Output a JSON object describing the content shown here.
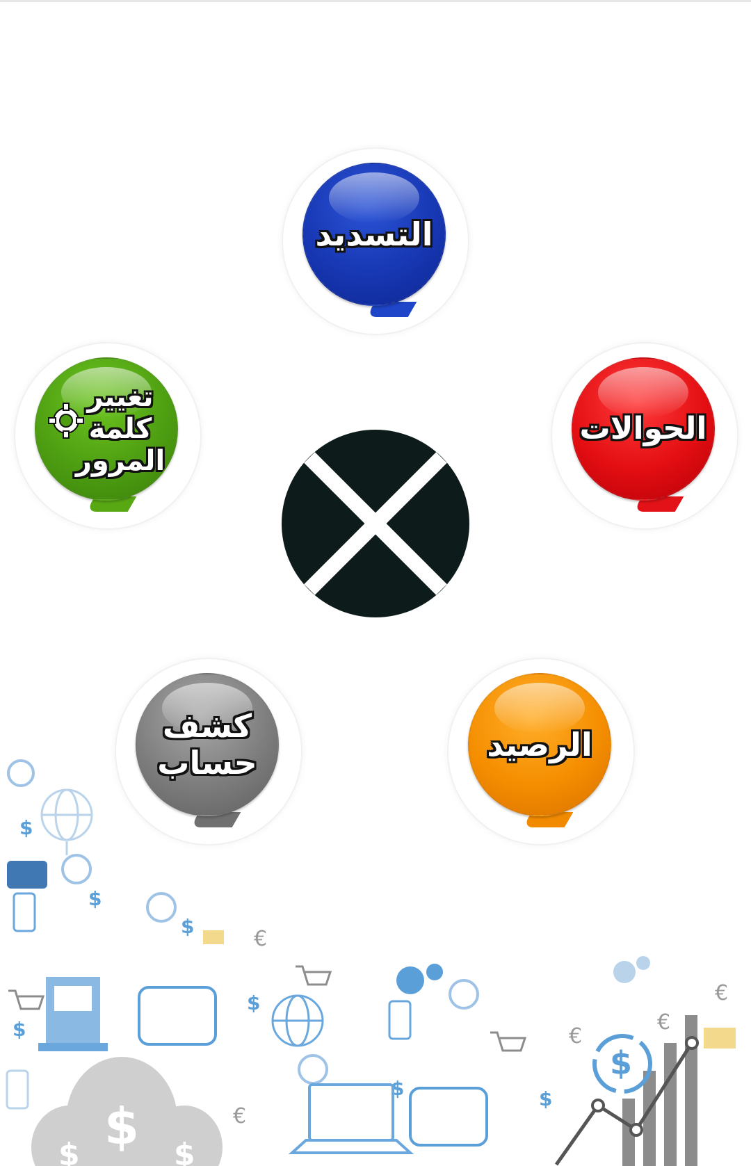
{
  "menu": {
    "payment": {
      "label": "التسديد",
      "color": "#1a3cbf"
    },
    "transfers": {
      "label": "الحوالات",
      "color": "#e31218"
    },
    "change_password": {
      "lines": [
        "تغيير",
        "كلمة",
        "المرور"
      ],
      "color": "#4e9e12"
    },
    "statement": {
      "lines": [
        "كشف",
        "حساب"
      ],
      "color": "#7d7d7d"
    },
    "balance": {
      "label": "الرصيد",
      "color": "#f58e00"
    }
  },
  "close_button": {
    "icon": "close-icon",
    "color": "#0d1b1b"
  },
  "background": {
    "icons": [
      "dollar-icon",
      "globe-icon",
      "cart-icon",
      "wallet-icon",
      "laptop-icon",
      "gear-icon",
      "money-bag-icon",
      "chart-icon",
      "euro-icon",
      "phone-icon",
      "envelope-icon"
    ]
  }
}
